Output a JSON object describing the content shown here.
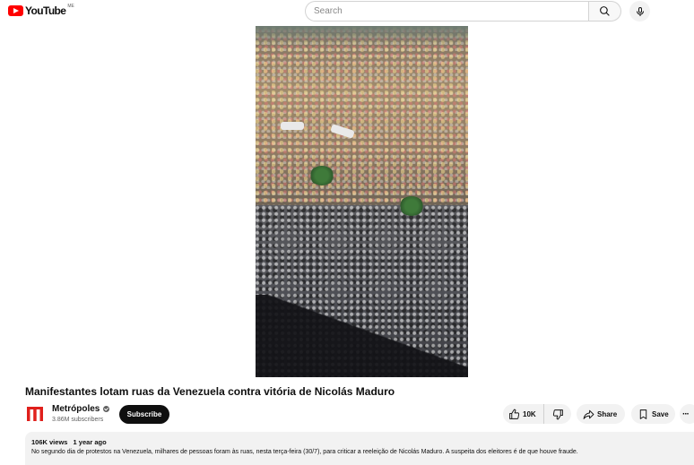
{
  "header": {
    "logo_text": "YouTube",
    "logo_country": "ME",
    "search_placeholder": "Search",
    "search_icon": "search-icon",
    "mic_icon": "microphone-icon"
  },
  "video": {
    "title": "Manifestantes lotam ruas da Venezuela contra vitória de Nicolás Maduro"
  },
  "channel": {
    "name": "Metrópoles",
    "subscribers": "3.86M subscribers",
    "logo_letter": "m",
    "logo_color": "#e0201c",
    "subscribe_label": "Subscribe"
  },
  "actions": {
    "like_count": "10K",
    "share_label": "Share",
    "save_label": "Save",
    "more_label": "···"
  },
  "description": {
    "views": "106K views",
    "age": "1 year ago",
    "text": "No segundo dia de protestos na Venezuela, milhares de pessoas foram às ruas, nesta terça-feira (30/7), para criticar a reeleição de Nicolás Maduro. A suspeita dos eleitores é de que houve fraude."
  },
  "colors": {
    "brand_red": "#ff0000",
    "subscribe_bg": "#0f0f0f",
    "pill_bg": "#f2f2f2"
  }
}
